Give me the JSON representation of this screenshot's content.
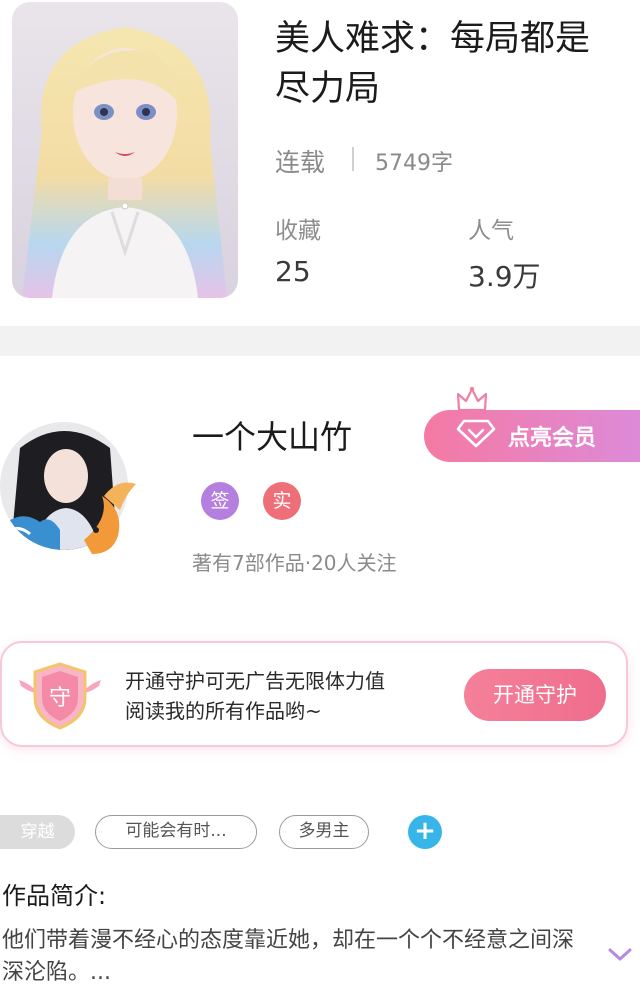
{
  "book": {
    "title": "美人难求：每局都是尽力局",
    "status": "连载",
    "word_count": "5749字",
    "stats": [
      {
        "label": "收藏",
        "value": "25"
      },
      {
        "label": "人气",
        "value": "3.9万"
      }
    ]
  },
  "author": {
    "name": "一个大山竹",
    "badges": [
      {
        "label": "签",
        "color": "#b57fe0"
      },
      {
        "label": "实",
        "color": "#ee6f77"
      }
    ],
    "meta": "著有7部作品·20人关注",
    "vip_button": "点亮会员"
  },
  "guard": {
    "icon_char": "守",
    "line1": "开通守护可无广告无限体力值",
    "line2": "阅读我的所有作品哟~",
    "button": "开通守护"
  },
  "tags": [
    "穿越",
    "可能会有时...",
    "多男主"
  ],
  "add_tag_icon": "+",
  "intro": {
    "title": "作品简介:",
    "text": "他们带着漫不经心的态度靠近她，却在一个个不经意之间深深沦陷。..."
  },
  "colors": {
    "accent_pink": "#f47aa3",
    "accent_purple": "#dd8ad8",
    "add_blue": "#37b5e9"
  }
}
